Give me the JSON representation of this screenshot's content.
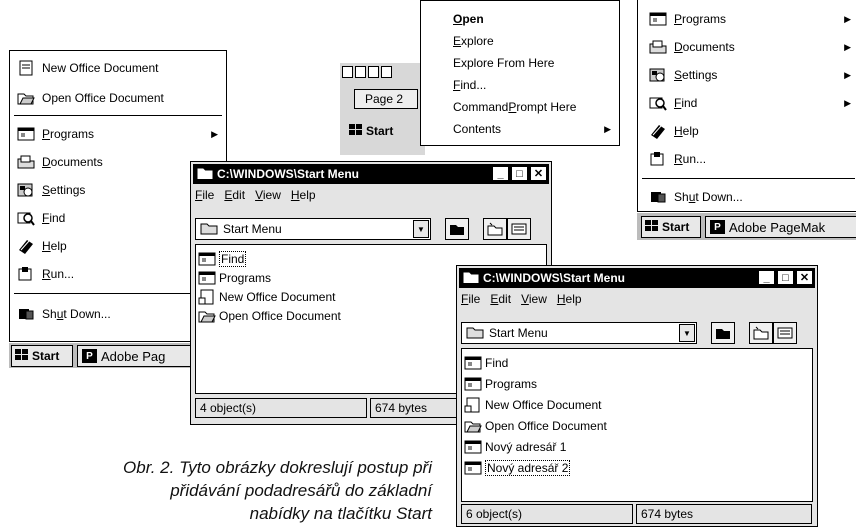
{
  "start_menu_left": {
    "top_items": [
      "New Office Document",
      "Open Office Document"
    ],
    "items": [
      "Programs",
      "Documents",
      "Settings",
      "Find",
      "Help",
      "Run..."
    ],
    "shutdown": "Shut Down...",
    "has_arrow": [
      true,
      false,
      false,
      false,
      false,
      false
    ]
  },
  "taskbar_left": {
    "start": "Start",
    "app": "Adobe Pag"
  },
  "context_menu": {
    "items": [
      "Open",
      "Explore",
      "Explore From Here",
      "Find...",
      "Command Prompt Here",
      "Contents"
    ]
  },
  "bg_toolbar": {
    "page_label": "Page 2",
    "start": "Start"
  },
  "start_menu_right": {
    "items": [
      "Programs",
      "Documents",
      "Settings",
      "Find",
      "Help",
      "Run..."
    ],
    "shutdown": "Shut Down...",
    "has_arrow": [
      true,
      true,
      true,
      true,
      false,
      false
    ]
  },
  "taskbar_right": {
    "start": "Start",
    "app": "Adobe PageMak"
  },
  "window1": {
    "title": "C:\\WINDOWS\\Start Menu",
    "menus": [
      "File",
      "Edit",
      "View",
      "Help"
    ],
    "address": "Start Menu",
    "files": [
      "Find",
      "Programs",
      "New Office Document",
      "Open Office Document"
    ],
    "status_count": "4 object(s)",
    "status_size": "674 bytes"
  },
  "window2": {
    "title": "C:\\WINDOWS\\Start Menu",
    "menus": [
      "File",
      "Edit",
      "View",
      "Help"
    ],
    "address": "Start Menu",
    "files": [
      "Find",
      "Programs",
      "New Office Document",
      "Open Office Document",
      "Nový adresář 1",
      "Nový adresář 2"
    ],
    "status_count": "6 object(s)",
    "status_size": "674 bytes"
  },
  "caption": {
    "line1": "Obr. 2. Tyto obrázky dokreslují postup při",
    "line2": "přidávání podadresářů do základní",
    "line3": "nabídky na tlačítku Start"
  }
}
